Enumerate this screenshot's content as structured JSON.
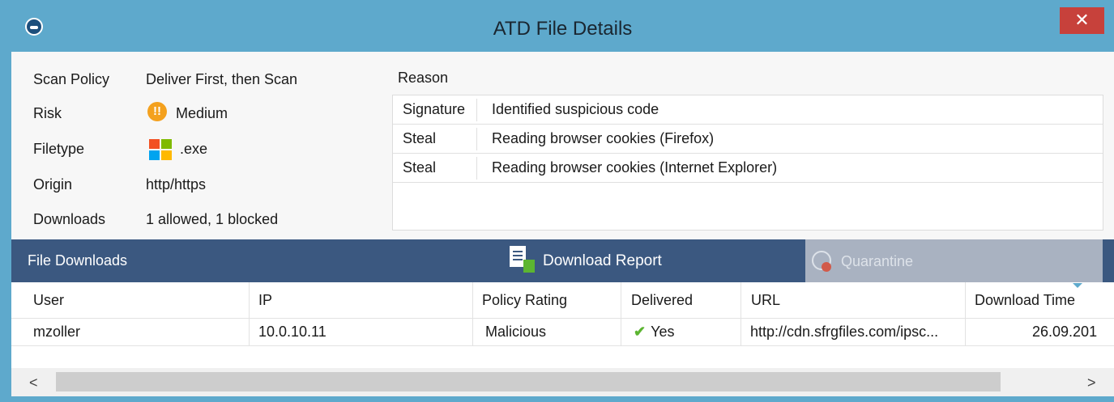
{
  "window": {
    "title": "ATD File Details",
    "close_label": "✕"
  },
  "details": {
    "scan_policy": {
      "label": "Scan Policy",
      "value": "Deliver First, then Scan"
    },
    "risk": {
      "label": "Risk",
      "value": "Medium",
      "icon": "warning-icon",
      "icon_glyph": "!!"
    },
    "filetype": {
      "label": "Filetype",
      "value": ".exe",
      "icon": "windows-logo-icon"
    },
    "origin": {
      "label": "Origin",
      "value": "http/https"
    },
    "downloads": {
      "label": "Downloads",
      "value": "1 allowed, 1 blocked"
    }
  },
  "reason": {
    "label": "Reason",
    "rows": [
      {
        "type": "Signature",
        "description": "Identified suspicious code"
      },
      {
        "type": "Steal",
        "description": "Reading browser cookies (Firefox)"
      },
      {
        "type": "Steal",
        "description": "Reading browser cookies (Internet Explorer)"
      }
    ]
  },
  "toolbar": {
    "title": "File Downloads",
    "download_report_label": "Download Report",
    "quarantine_label": "Quarantine"
  },
  "downloads_table": {
    "columns": [
      "User",
      "IP",
      "Policy Rating",
      "Delivered",
      "URL",
      "Download Time"
    ],
    "rows": [
      {
        "user": "mzoller",
        "ip": "10.0.10.11",
        "policy_rating": "Malicious",
        "delivered": "Yes",
        "url": "http://cdn.sfrgfiles.com/ipsc...",
        "download_time": "26.09.201"
      }
    ]
  },
  "scrollbar": {
    "left_glyph": "<",
    "right_glyph": ">"
  },
  "colors": {
    "titlebar": "#5ea9cc",
    "close": "#c7413b",
    "toolbar": "#3b5880",
    "quarantine_disabled": "#a9b2c1",
    "risk_medium": "#f4a11e",
    "check": "#5cb531"
  }
}
